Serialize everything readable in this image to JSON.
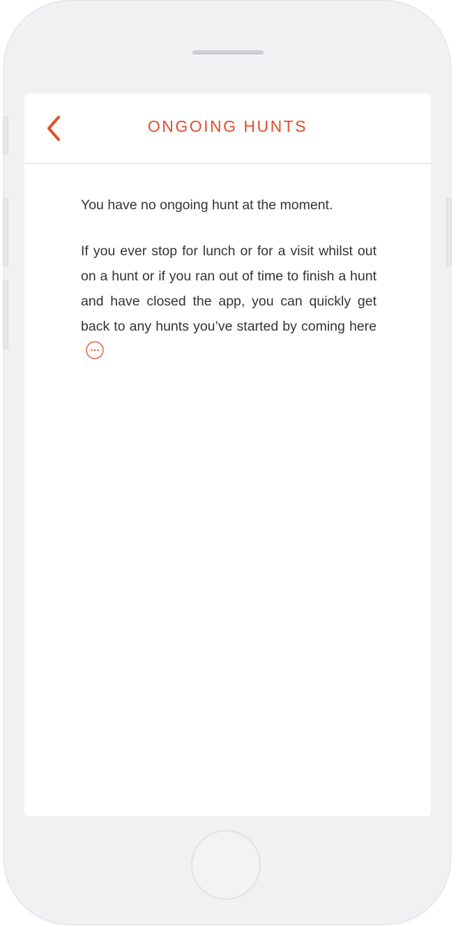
{
  "header": {
    "title": "ONGOING HUNTS",
    "back_icon": "chevron-left-icon"
  },
  "content": {
    "paragraph1": "You have no ongoing hunt at the moment.",
    "paragraph2": "If you ever stop for lunch or for a visit whilst out on a hunt or if you ran out of time to finish a hunt and have closed the app, you can quickly get back to any hunts you’ve started by coming here",
    "inline_icon": "more-dots-icon"
  },
  "colors": {
    "accent": "#e04e2c",
    "text": "#333333",
    "background": "#ffffff",
    "device": "#f1f1f3"
  }
}
